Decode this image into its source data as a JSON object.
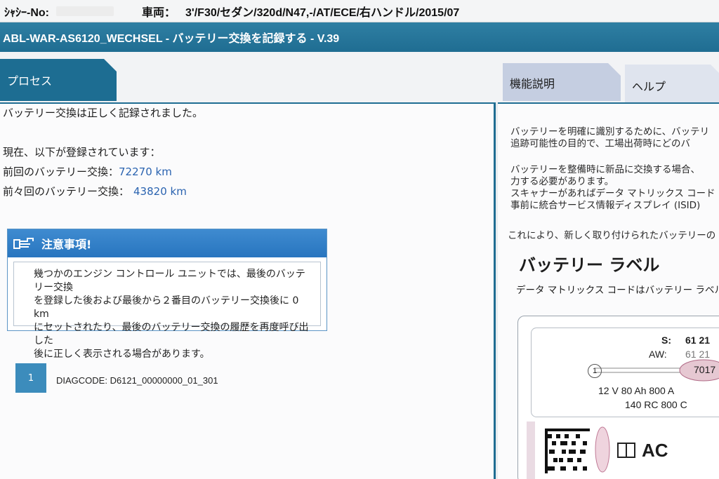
{
  "topbar": {
    "chassis_label": "ｼｬｼｰ-No:",
    "vehicle_label": "車両：",
    "vehicle_value": "3'/F30/セダン/320d/N47,-/AT/ECE/右ハンドル/2015/07"
  },
  "title": "ABL-WAR-AS6120_WECHSEL - バッテリー交換を記録する - V.39",
  "tabs": {
    "process": "プロセス",
    "function_description": "機能説明",
    "help": "ヘルプ"
  },
  "main": {
    "status": "バッテリー交換は正しく記録されました。",
    "registered_intro": "現在、以下が登録されています：",
    "previous_label": "前回のバッテリー交換：",
    "previous_value": "72270 km",
    "before_previous_label": "前々回のバッテリー交換：",
    "before_previous_value": "43820 km",
    "notice": {
      "title": "注意事項!",
      "lines": [
        "幾つかのエンジン コントロール ユニットでは、最後のバッテリー交換",
        "を登録した後および最後から２番目のバッテリー交換後に 0 km",
        "にセットされたり、最後のバッテリー交換の履歴を再度呼び出した",
        "後に正しく表示される場合があります。"
      ]
    },
    "step_number": "1",
    "diagcode": "DIAGCODE: D6121_00000000_01_301"
  },
  "side": {
    "paragraph1": [
      "バッテリーを明確に識別するために、バッテリ",
      "追跡可能性の目的で、工場出荷時にどのバ"
    ],
    "paragraph2": [
      "バッテリーを整備時に新品に交換する場合、",
      "力する必要があります。",
      "スキャナーがあればデータ マトリックス コード",
      "事前に統合サービス情報ディスプレイ (ISID)"
    ],
    "paragraph3": "これにより、新しく取り付けられたバッテリーの",
    "heading": "バッテリー ラベル",
    "subtext": "データ マトリックス コードはバッテリー ラベル",
    "figure": {
      "s_label": "S:",
      "s_value": "61 21",
      "aw_label": "AW:",
      "aw_value": "61 21",
      "callout_number": "1",
      "oval_value": "7017",
      "spec_line1": "12 V  80 Ah   800 A",
      "spec_line2": "140 RC 800 C",
      "brand_partial": "AC"
    }
  },
  "colors": {
    "accent": "#1f6d92",
    "notice_header": "#2f80c8",
    "value_blue": "#2a63b0",
    "step_box": "#3c8cbc"
  }
}
